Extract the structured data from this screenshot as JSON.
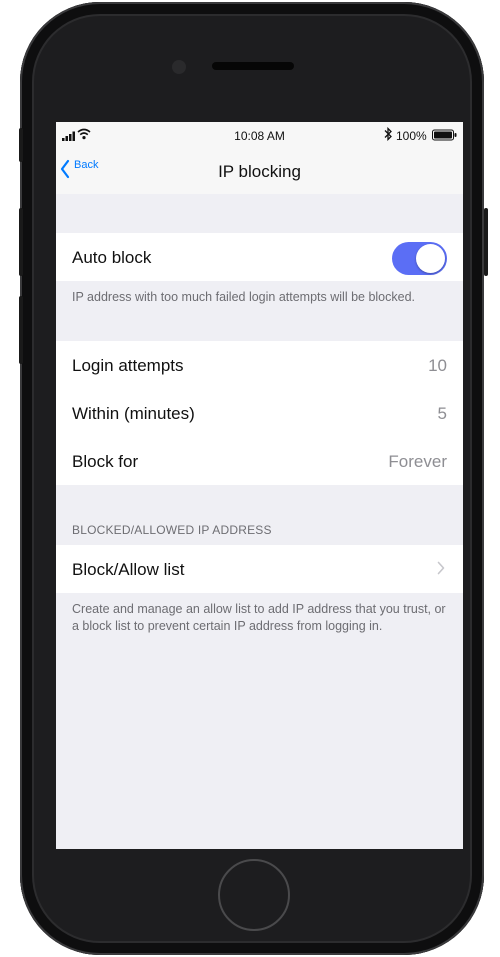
{
  "status_bar": {
    "time": "10:08 AM",
    "battery_text": "100%",
    "icons": [
      "signal-icon",
      "wifi-icon",
      "bluetooth-icon",
      "battery-icon"
    ]
  },
  "nav": {
    "back_label": "Back",
    "title": "IP blocking"
  },
  "auto_block": {
    "label": "Auto block",
    "toggle_on": true,
    "footer": "IP address with too much failed login attempts will be blocked."
  },
  "settings": [
    {
      "label": "Login attempts",
      "value": "10"
    },
    {
      "label": "Within (minutes)",
      "value": "5"
    },
    {
      "label": "Block for",
      "value": "Forever"
    }
  ],
  "ip_section": {
    "header": "BLOCKED/ALLOWED IP ADDRESS",
    "list_label": "Block/Allow list",
    "footer": "Create and manage an allow list to add IP address that you trust, or a block list to prevent certain IP address from logging in."
  },
  "colors": {
    "accent": "#007aff",
    "toggle_on": "#5b6ef5",
    "background": "#efeff4"
  }
}
